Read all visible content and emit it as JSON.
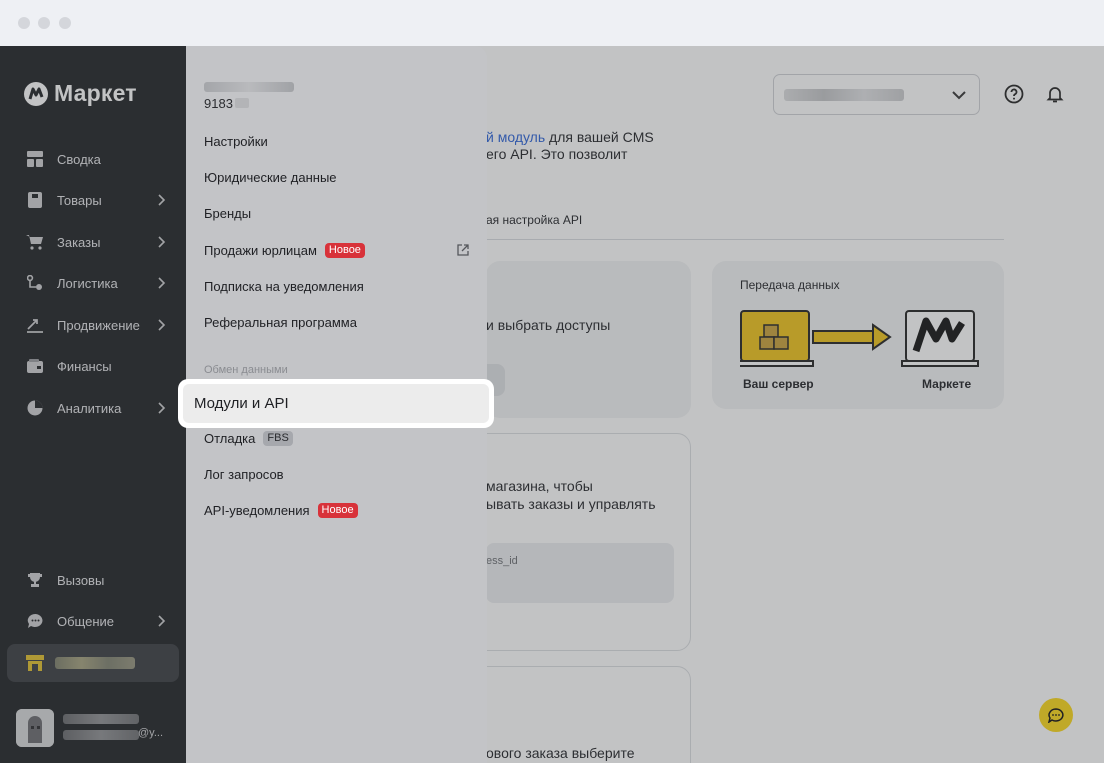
{
  "brand": {
    "logo_text": "Маркет"
  },
  "sidebar": {
    "items": [
      {
        "label": "Сводка",
        "icon": "dashboard-icon",
        "has_submenu": false
      },
      {
        "label": "Товары",
        "icon": "products-icon",
        "has_submenu": true
      },
      {
        "label": "Заказы",
        "icon": "cart-icon",
        "has_submenu": true
      },
      {
        "label": "Логистика",
        "icon": "logistics-icon",
        "has_submenu": true
      },
      {
        "label": "Продвижение",
        "icon": "promotion-icon",
        "has_submenu": true
      },
      {
        "label": "Финансы",
        "icon": "wallet-icon",
        "has_submenu": false
      },
      {
        "label": "Аналитика",
        "icon": "pie-chart-icon",
        "has_submenu": true
      }
    ],
    "bottom_items": [
      {
        "label": "Вызовы",
        "icon": "trophy-icon",
        "has_submenu": false
      },
      {
        "label": "Общение",
        "icon": "chat-bubble-icon",
        "has_submenu": true
      }
    ],
    "user": {
      "email_suffix": "@y..."
    }
  },
  "header": {
    "store_selector_icon": "chevron-down-icon",
    "help_icon": "help-circle-icon",
    "notifications_icon": "bell-icon"
  },
  "page": {
    "intro_link": "й модуль",
    "intro_line1_rest": " для вашей CMS",
    "intro_line2": "его API. Это позволит",
    "tab_partial": "ая настройка API",
    "card1_text": "и выбрать доступы",
    "data_transfer": {
      "title": "Передача данных",
      "left_caption": "Ваш сервер",
      "right_caption": "Маркете"
    },
    "card2_line1": "магазина, чтобы",
    "card2_line2": "ывать заказы и управлять",
    "card2_field": "ess_id",
    "card3_text": "ового заказа выберите"
  },
  "menu": {
    "account_id": "9183",
    "items": [
      {
        "label": "Настройки"
      },
      {
        "label": "Юридические данные"
      },
      {
        "label": "Бренды"
      },
      {
        "label": "Продажи юрлицам",
        "badge": "Новое",
        "external": true
      },
      {
        "label": "Подписка на уведомления"
      },
      {
        "label": "Реферальная программа"
      }
    ],
    "section_label": "Обмен данными",
    "highlighted": "Модули и API",
    "section_items": [
      {
        "label": "Отладка",
        "badge": "FBS"
      },
      {
        "label": "Лог запросов"
      },
      {
        "label": "API-уведомления",
        "badge": "Новое"
      }
    ]
  },
  "colors": {
    "sidebar_bg": "#1f2124",
    "accent_yellow": "#c0a928",
    "badge_red": "#d8323a",
    "link_blue": "#2b63d9"
  }
}
